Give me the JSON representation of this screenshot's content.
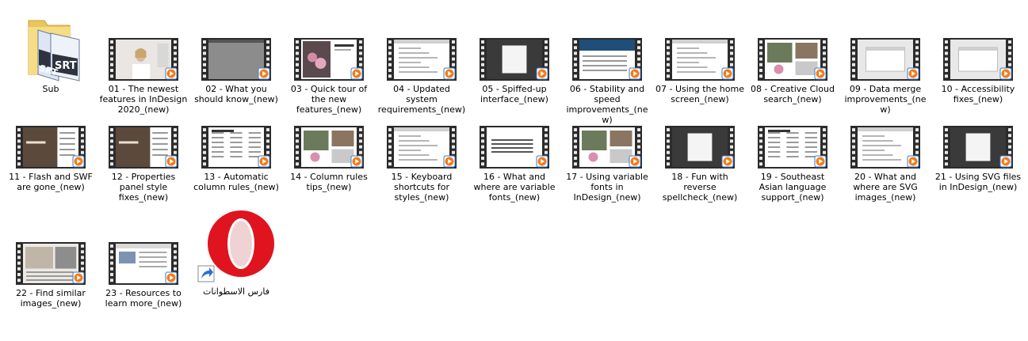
{
  "folder": {
    "label": "Sub",
    "icon": "folder-srt-icon",
    "badge_text_1": "SRT",
    "badge_text_2": "SRT"
  },
  "videos": [
    {
      "label": "01 - The newest features in InDesign 2020_(new)",
      "thumb": "person"
    },
    {
      "label": "02 - What you should know_(new)",
      "thumb": "gray"
    },
    {
      "label": "03 - Quick tour of the new features_(new)",
      "thumb": "flowers"
    },
    {
      "label": "04 - Updated system requirements_(new)",
      "thumb": "doc"
    },
    {
      "label": "05 - Spiffed-up interface_(new)",
      "thumb": "dark"
    },
    {
      "label": "06 - Stability and speed improvements_(new)",
      "thumb": "slide"
    },
    {
      "label": "07 - Using the home screen_(new)",
      "thumb": "doc"
    },
    {
      "label": "08 - Creative Cloud search_(new)",
      "thumb": "photos"
    },
    {
      "label": "09 - Data merge improvements_(new)",
      "thumb": "dialog"
    },
    {
      "label": "10 - Accessibility fixes_(new)",
      "thumb": "dialog"
    },
    {
      "label": "11 - Flash and SWF are gone_(new)",
      "thumb": "magazine"
    },
    {
      "label": "12 - Properties panel style fixes_(new)",
      "thumb": "magazine"
    },
    {
      "label": "13 - Automatic column rules_(new)",
      "thumb": "columns"
    },
    {
      "label": "14 - Column rules tips_(new)",
      "thumb": "photos"
    },
    {
      "label": "15 - Keyboard shortcuts for styles_(new)",
      "thumb": "doc"
    },
    {
      "label": "16 - What and where are variable fonts_(new)",
      "thumb": "text"
    },
    {
      "label": "17 - Using variable fonts in InDesign_(new)",
      "thumb": "photos"
    },
    {
      "label": "18 - Fun with reverse spellcheck_(new)",
      "thumb": "dark"
    },
    {
      "label": "19 - Southeast Asian language support_(new)",
      "thumb": "columns"
    },
    {
      "label": "20 - What and where are SVG images_(new)",
      "thumb": "doc"
    },
    {
      "label": "21 - Using SVG files in InDesign_(new)",
      "thumb": "dark"
    },
    {
      "label": "22 - Find similar images_(new)",
      "thumb": "room"
    },
    {
      "label": "23 - Resources to learn more_(new)",
      "thumb": "web"
    }
  ],
  "shortcut": {
    "label": "فارس الاسطوانات",
    "icon": "opera-icon",
    "overlay_icon": "shortcut-arrow-icon"
  },
  "colors": {
    "film": "#2b2b2b",
    "play_badge": "#f07d1a",
    "play_border": "#3a7bd5",
    "opera_red": "#e0141e",
    "opera_dark": "#a40a12"
  }
}
